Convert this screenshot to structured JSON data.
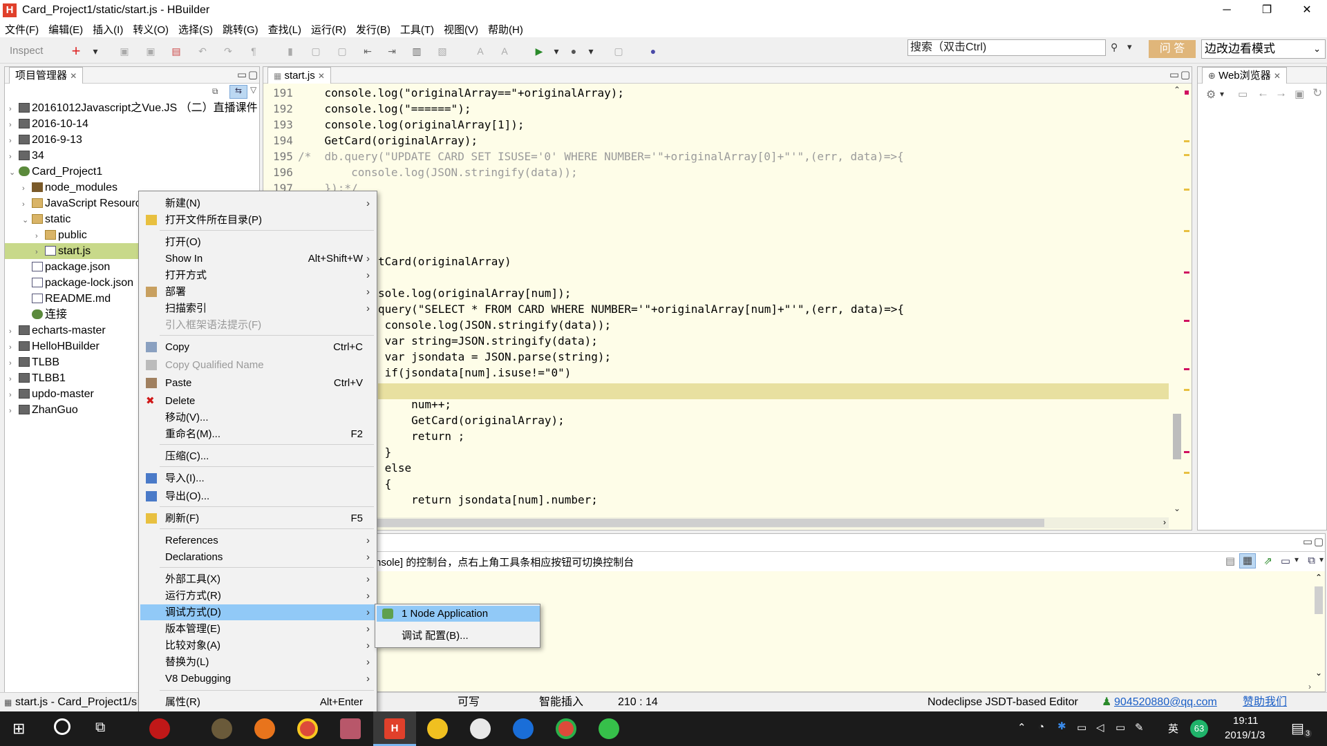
{
  "window": {
    "title": "Card_Project1/static/start.js  -  HBuilder",
    "minimize": "─",
    "maximize": "❐",
    "close": "✕"
  },
  "menu": [
    "文件(F)",
    "编辑(E)",
    "插入(I)",
    "转义(O)",
    "选择(S)",
    "跳转(G)",
    "查找(L)",
    "运行(R)",
    "发行(B)",
    "工具(T)",
    "视图(V)",
    "帮助(H)"
  ],
  "toolbar": {
    "inspect": "Inspect",
    "search_placeholder": "搜索（双击Ctrl)",
    "ask_button": "问 答",
    "mode_select": "边改边看模式"
  },
  "project_panel": {
    "title": "项目管理器",
    "items": [
      {
        "label": "20161012Javascript之Vue.JS （二）直播课件",
        "depth": 0,
        "arrow": "›"
      },
      {
        "label": "2016-10-14",
        "depth": 0,
        "arrow": "›"
      },
      {
        "label": "2016-9-13",
        "depth": 0,
        "arrow": "›"
      },
      {
        "label": "34",
        "depth": 0,
        "arrow": "›"
      },
      {
        "label": "Card_Project1",
        "depth": 0,
        "arrow": "⌄"
      },
      {
        "label": "node_modules",
        "depth": 1,
        "arrow": "›"
      },
      {
        "label": "JavaScript Resources",
        "depth": 1,
        "arrow": "›"
      },
      {
        "label": "static",
        "depth": 1,
        "arrow": "⌄"
      },
      {
        "label": "public",
        "depth": 2,
        "arrow": "›"
      },
      {
        "label": "start.js",
        "depth": 2,
        "arrow": "›"
      },
      {
        "label": "package.json",
        "depth": 1,
        "arrow": ""
      },
      {
        "label": "package-lock.json",
        "depth": 1,
        "arrow": ""
      },
      {
        "label": "README.md",
        "depth": 1,
        "arrow": ""
      },
      {
        "label": "连接",
        "depth": 1,
        "arrow": ""
      },
      {
        "label": "echarts-master",
        "depth": 0,
        "arrow": "›"
      },
      {
        "label": "HelloHBuilder",
        "depth": 0,
        "arrow": "›"
      },
      {
        "label": "TLBB",
        "depth": 0,
        "arrow": "›"
      },
      {
        "label": "TLBB1",
        "depth": 0,
        "arrow": "›"
      },
      {
        "label": "updo-master",
        "depth": 0,
        "arrow": "›"
      },
      {
        "label": "ZhanGuo",
        "depth": 0,
        "arrow": "›"
      }
    ]
  },
  "editor": {
    "tab": "start.js",
    "lines": [
      {
        "n": "191",
        "code": "    console.log(\"originalArray==\"+originalArray);"
      },
      {
        "n": "192",
        "code": "    console.log(\"======\");"
      },
      {
        "n": "193",
        "code": "    console.log(originalArray[1]);"
      },
      {
        "n": "194",
        "code": "    GetCard(originalArray);"
      },
      {
        "n": "195",
        "code": "/*  db.query(\"UPDATE CARD SET ISUSE='0' WHERE NUMBER='\"+originalArray[0]+\"'\",(err, data)=>{"
      },
      {
        "n": "196",
        "code": "        console.log(JSON.stringify(data));"
      },
      {
        "n": "197",
        "code": "    });*/"
      }
    ],
    "partial_lines": [
      "tCard(originalArray)",
      "",
      "sole.log(originalArray[num]);",
      "query(\"SELECT * FROM CARD WHERE NUMBER='\"+originalArray[num]+\"'\",(err, data)=>{",
      " console.log(JSON.stringify(data));",
      " var string=JSON.stringify(data);",
      " var jsondata = JSON.parse(string);",
      " if(jsondata[num].isuse!=\"0\")",
      " {",
      "     num++;",
      "     GetCard(originalArray);",
      "     return ;",
      " }",
      " else",
      " {",
      "     return jsondata[num].number;"
    ]
  },
  "web_browser": {
    "title": "Web浏览器"
  },
  "console": {
    "text": "nsole] 的控制台，点右上角工具条相应按钮可切换控制台"
  },
  "context_menu": [
    {
      "label": "新建(N)",
      "shortcut": "",
      "sub": true
    },
    {
      "label": "打开文件所在目录(P)",
      "shortcut": "",
      "sub": false
    },
    {
      "label": "打开(O)",
      "shortcut": "",
      "sub": false
    },
    {
      "label": "Show In",
      "shortcut": "Alt+Shift+W",
      "sub": true
    },
    {
      "label": "打开方式",
      "shortcut": "",
      "sub": true
    },
    {
      "label": "部署",
      "shortcut": "",
      "sub": true
    },
    {
      "label": "扫描索引",
      "shortcut": "",
      "sub": true
    },
    {
      "label": "引入框架语法提示(F)",
      "shortcut": "",
      "sub": false
    },
    {
      "label": "Copy",
      "shortcut": "Ctrl+C",
      "sub": false
    },
    {
      "label": "Copy Qualified Name",
      "shortcut": "",
      "sub": false
    },
    {
      "label": "Paste",
      "shortcut": "Ctrl+V",
      "sub": false
    },
    {
      "label": "Delete",
      "shortcut": "",
      "sub": false
    },
    {
      "label": "移动(V)...",
      "shortcut": "",
      "sub": false
    },
    {
      "label": "重命名(M)...",
      "shortcut": "F2",
      "sub": false
    },
    {
      "label": "压缩(C)...",
      "shortcut": "",
      "sub": false
    },
    {
      "label": "导入(I)...",
      "shortcut": "",
      "sub": false
    },
    {
      "label": "导出(O)...",
      "shortcut": "",
      "sub": false
    },
    {
      "label": "刷新(F)",
      "shortcut": "F5",
      "sub": false
    },
    {
      "label": "References",
      "shortcut": "",
      "sub": true
    },
    {
      "label": "Declarations",
      "shortcut": "",
      "sub": true
    },
    {
      "label": "外部工具(X)",
      "shortcut": "",
      "sub": true
    },
    {
      "label": "运行方式(R)",
      "shortcut": "",
      "sub": true
    },
    {
      "label": "调试方式(D)",
      "shortcut": "",
      "sub": true
    },
    {
      "label": "版本管理(E)",
      "shortcut": "",
      "sub": true
    },
    {
      "label": "比较对象(A)",
      "shortcut": "",
      "sub": true
    },
    {
      "label": "替换为(L)",
      "shortcut": "",
      "sub": true
    },
    {
      "label": "V8 Debugging",
      "shortcut": "",
      "sub": true
    },
    {
      "label": "属性(R)",
      "shortcut": "Alt+Enter",
      "sub": false
    }
  ],
  "submenu": [
    {
      "label": "1 Node Application"
    },
    {
      "label": "调试 配置(B)..."
    }
  ],
  "statusbar": {
    "file": "start.js - Card_Project1/s",
    "writable": "可写",
    "insert_mode": "智能插入",
    "position": "210 :  14",
    "editor_name": "Nodeclipse JSDT-based Editor",
    "email": "904520880@qq.com",
    "sponsor": "赞助我们"
  },
  "taskbar": {
    "time": "19:11",
    "date": "2019/1/3",
    "ime": "英",
    "battery": "63",
    "notif_count": "3"
  },
  "colors": {
    "editor_bg": "#fefde8",
    "highlight_line": "#e8e0a0",
    "menu_highlight": "#91c9f7",
    "selection": "#c8d98a"
  }
}
